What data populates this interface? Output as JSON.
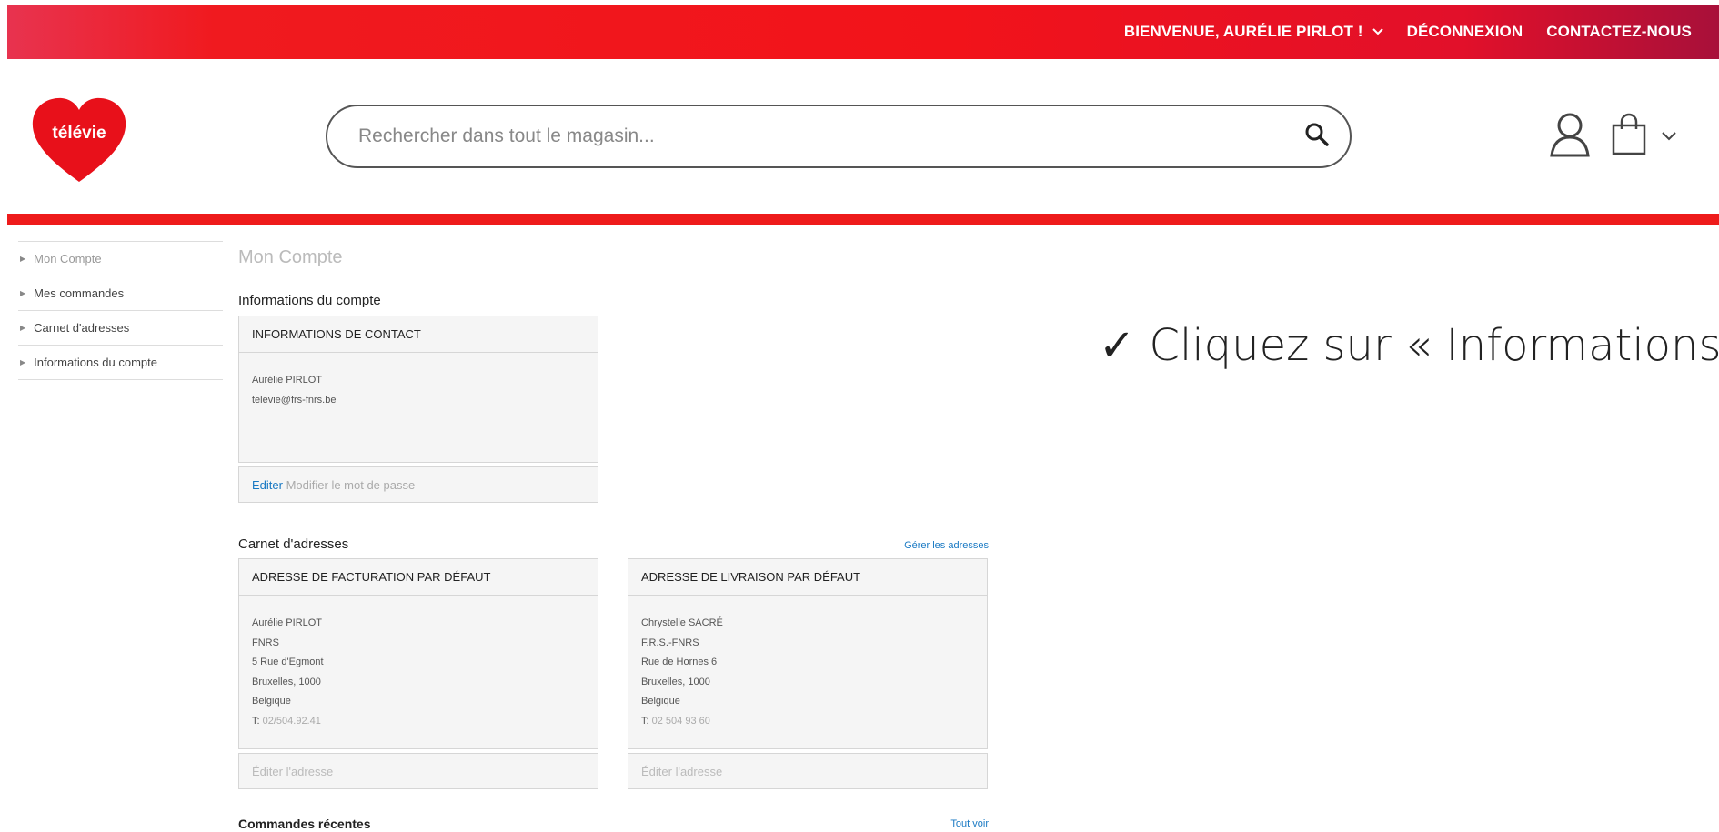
{
  "topbar": {
    "welcome": "BIENVENUE, AURÉLIE PIRLOT !",
    "logout": "DÉCONNEXION",
    "contact": "CONTACTEZ-NOUS"
  },
  "header": {
    "logo_text": "télévie",
    "search_placeholder": "Rechercher dans tout le magasin..."
  },
  "sidebar": {
    "items": [
      {
        "label": "Mon Compte"
      },
      {
        "label": "Mes commandes"
      },
      {
        "label": "Carnet d'adresses"
      },
      {
        "label": "Informations du compte"
      }
    ]
  },
  "main": {
    "page_title": "Mon Compte",
    "account_info": {
      "title": "Informations du compte",
      "box_title": "INFORMATIONS DE CONTACT",
      "name": "Aurélie PIRLOT",
      "email": "televie@frs-fnrs.be",
      "edit": "Editer",
      "change_password": "Modifier le mot de passe"
    },
    "address_book": {
      "title": "Carnet d'adresses",
      "manage": "Gérer les adresses",
      "billing": {
        "title": "ADRESSE DE FACTURATION PAR DÉFAUT",
        "lines": [
          "Aurélie PIRLOT",
          "FNRS",
          "5 Rue d'Egmont",
          "Bruxelles, 1000",
          "Belgique"
        ],
        "phone_label": "T:",
        "phone": "02/504.92.41",
        "edit": "Éditer l'adresse"
      },
      "shipping": {
        "title": "ADRESSE DE LIVRAISON PAR DÉFAUT",
        "lines": [
          "Chrystelle SACRÉ",
          "F.R.S.-FNRS",
          "Rue de Hornes 6",
          "Bruxelles, 1000",
          "Belgique"
        ],
        "phone_label": "T:",
        "phone": "02 504 93 60",
        "edit": "Éditer l'adresse"
      }
    },
    "recent_orders": {
      "title": "Commandes récentes",
      "view_all": "Tout voir"
    }
  },
  "callout": {
    "check": "✓",
    "text": "Cliquez sur « Informations d"
  },
  "colors": {
    "brand_red": "#ee1b1b",
    "link_blue": "#1979c3"
  }
}
